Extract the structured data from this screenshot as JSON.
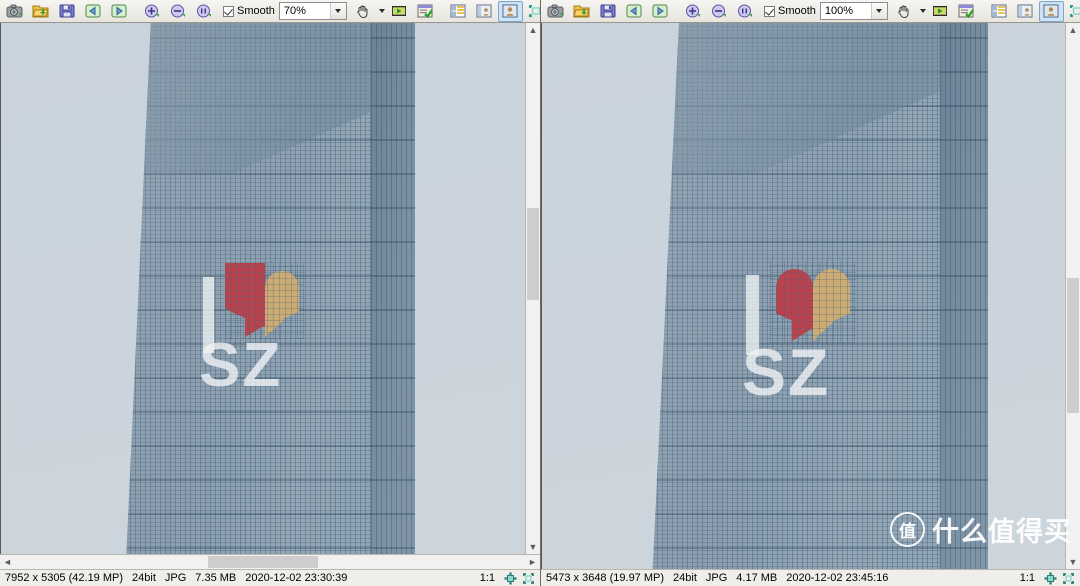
{
  "app": {
    "name": "image-viewer-dual-pane",
    "accent_selected": "#cfe3f7",
    "sky_color": "#ccd5dc",
    "building_color": "#8799ab"
  },
  "toolbar": {
    "smooth_label": "Smooth",
    "buttons": [
      {
        "name": "capture-button",
        "icon": "camera-icon",
        "label": "Capture"
      },
      {
        "name": "open-button",
        "icon": "open-folder-icon",
        "label": "Open"
      },
      {
        "name": "save-button",
        "icon": "floppy-save-icon",
        "label": "Save"
      },
      {
        "name": "previous-button",
        "icon": "arrow-left-icon",
        "label": "Previous"
      },
      {
        "name": "next-button",
        "icon": "arrow-right-icon",
        "label": "Next"
      },
      {
        "name": "zoom-in-button",
        "icon": "zoom-in-icon",
        "label": "Zoom In"
      },
      {
        "name": "zoom-out-button",
        "icon": "zoom-out-icon",
        "label": "Zoom Out"
      },
      {
        "name": "actual-size-button",
        "icon": "actual-size-icon",
        "label": "Actual Size"
      },
      {
        "name": "pan-tool-button",
        "icon": "hand-icon",
        "label": "Pan"
      },
      {
        "name": "slideshow-button",
        "icon": "filmstrip-icon",
        "label": "Slideshow"
      },
      {
        "name": "options-button",
        "icon": "checklist-window-icon",
        "label": "Options"
      },
      {
        "name": "view-grid-button",
        "icon": "grid-view-icon",
        "label": "Grid View"
      },
      {
        "name": "view-split-button",
        "icon": "split-view-icon",
        "label": "Split View"
      },
      {
        "name": "view-single-button",
        "icon": "single-view-icon",
        "label": "Single View"
      },
      {
        "name": "fullscreen-button",
        "icon": "fullscreen-icon",
        "label": "Full Screen"
      }
    ]
  },
  "panes": [
    {
      "id": "left",
      "zoom_value": "70%",
      "status": {
        "dimensions": "7952 x 5305 (42.19 MP)",
        "bit_depth": "24bit",
        "format": "JPG",
        "filesize": "7.35 MB",
        "datetime": "2020-12-02 23:30:39",
        "ratio": "1:1"
      }
    },
    {
      "id": "right",
      "zoom_value": "100%",
      "status": {
        "dimensions": "5473 x 3648 (19.97 MP)",
        "bit_depth": "24bit",
        "format": "JPG",
        "filesize": "4.17 MB",
        "datetime": "2020-12-02 23:45:16",
        "ratio": "1:1"
      }
    }
  ],
  "photo": {
    "mural_text": "SZ",
    "mural_letter": "I",
    "heart_left_color": "#b8434f",
    "heart_right_color": "#ccab74"
  },
  "watermark": {
    "logo_char": "值",
    "text": "什么值得买"
  }
}
